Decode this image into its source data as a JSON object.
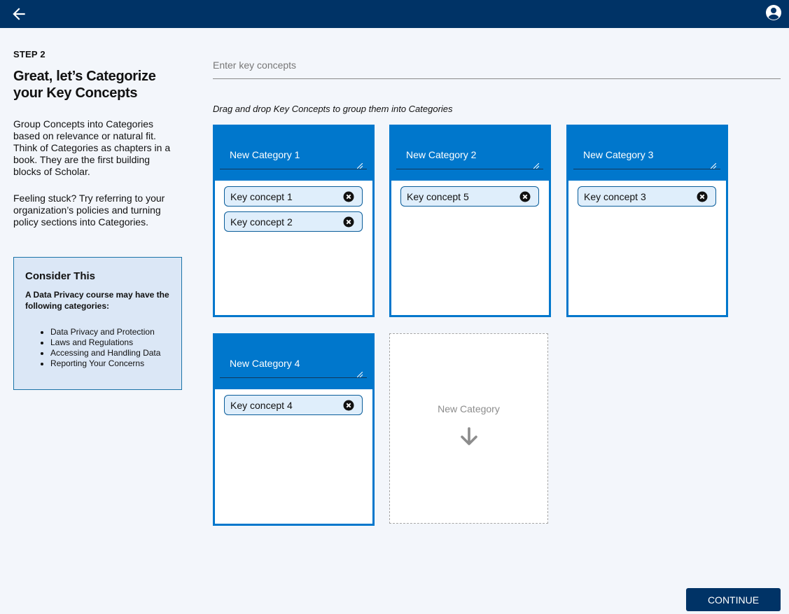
{
  "sidebar": {
    "step": "STEP 2",
    "title_line1": "Great, let’s Categorize",
    "title_line2": "your Key Concepts",
    "para1": "Group Concepts into Categories based on relevance or natural fit. Think of Categories as chapters in a book. They are the first building blocks of Scholar.",
    "para2": "Feeling stuck? Try referring to your organization’s policies and turning policy sections into Categories."
  },
  "consider": {
    "title": "Consider This",
    "subtitle": "A Data Privacy course may have the following categories:",
    "items": [
      "Data Privacy and Protection",
      "Laws and Regulations",
      "Accessing and Handling Data",
      "Reporting Your Concerns"
    ]
  },
  "key_input": {
    "placeholder": "Enter key concepts"
  },
  "instruction": "Drag and drop Key Concepts to group them into Categories",
  "categories": [
    {
      "name": "New Category 1",
      "concepts": [
        "Key concept 1",
        "Key concept 2"
      ]
    },
    {
      "name": "New Category 2",
      "concepts": [
        "Key concept 5"
      ]
    },
    {
      "name": "New Category 3",
      "concepts": [
        "Key concept 3"
      ]
    },
    {
      "name": "New Category 4",
      "concepts": [
        "Key concept 4"
      ]
    }
  ],
  "new_category_label": "New Category",
  "continue_label": "CONTINUE",
  "icons": {
    "back": "arrow-left-icon",
    "user": "user-circle-icon",
    "remove": "close-circle-icon",
    "add": "arrow-down-icon"
  },
  "colors": {
    "header": "#003366",
    "accent": "#0077cc",
    "chip_bg": "#dfeefb",
    "background": "#f3f6fb"
  }
}
